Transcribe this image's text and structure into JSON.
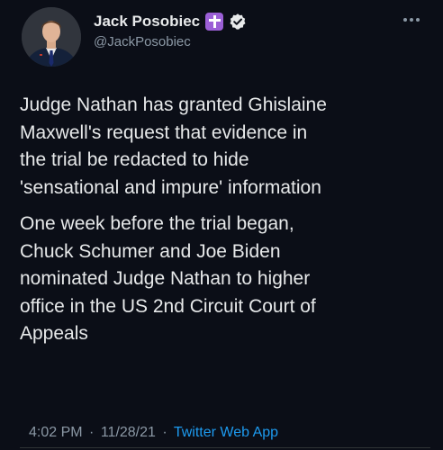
{
  "tweet": {
    "author": {
      "display_name": "Jack Posobiec",
      "handle": "@JackPosobiec",
      "badges": [
        "cross-icon",
        "verified-icon"
      ]
    },
    "paragraphs": [
      "Judge Nathan has granted Ghislaine\nMaxwell's request that evidence in\nthe trial be redacted to hide\n'sensational and impure' information",
      "One week before the trial began,\nChuck Schumer and Joe Biden\nnominated Judge Nathan to higher\noffice in the US 2nd Circuit Court of\nAppeals"
    ],
    "time": "4:02 PM",
    "separator": "·",
    "date": "11/28/21",
    "source": "Twitter Web App"
  },
  "colors": {
    "background": "#0b0e17",
    "text": "#e7e9ea",
    "muted": "#8b98a5",
    "link": "#1d9bf0",
    "cross_badge": "#9b5fd6",
    "verified": "#1d9bf0"
  }
}
